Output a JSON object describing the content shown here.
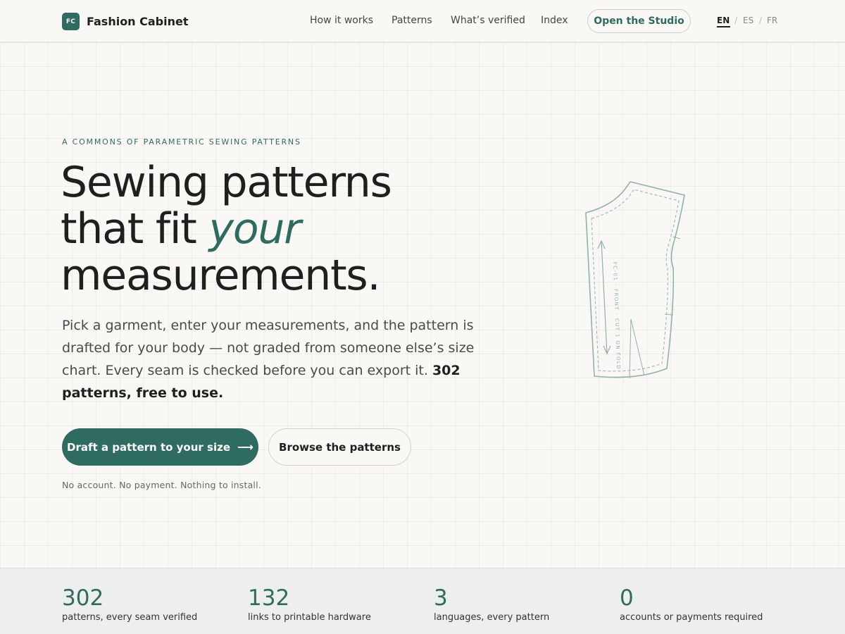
{
  "brand": {
    "mark": "FC",
    "name": "Fashion Cabinet",
    "color": "#2e6b60"
  },
  "nav": {
    "items": [
      "How it works",
      "Patterns",
      "What’s verified",
      "Index"
    ],
    "cta": "Open the Studio",
    "languages": [
      "EN",
      "ES",
      "FR"
    ],
    "active_language": "EN",
    "separator": "/"
  },
  "hero": {
    "eyebrow": "A COMMONS OF PARAMETRIC SEWING PATTERNS",
    "headline_line1": "Sewing patterns",
    "headline_line2_pre": "that fit ",
    "headline_line2_em": "your",
    "headline_line3": "measurements.",
    "lede": "Pick a garment, enter your measurements, and the pattern is drafted for your body — not graded from someone else’s size chart. Every seam is checked before you can export it. ",
    "lede_strong": "302 patterns, free to use.",
    "primary_cta": "Draft a pattern to your size",
    "primary_cta_icon": "arrow-right-icon",
    "secondary_cta": "Browse the patterns",
    "fineprint": "No account. No payment. Nothing to install.",
    "pattern_piece_label": "FC-01 · FRONT · CUT 1 ON FOLD"
  },
  "stats": [
    {
      "value": "302",
      "label": "patterns, every seam verified"
    },
    {
      "value": "132",
      "label": "links to printable hardware"
    },
    {
      "value": "3",
      "label": "languages, every pattern"
    },
    {
      "value": "0",
      "label": "accounts or payments required"
    }
  ]
}
